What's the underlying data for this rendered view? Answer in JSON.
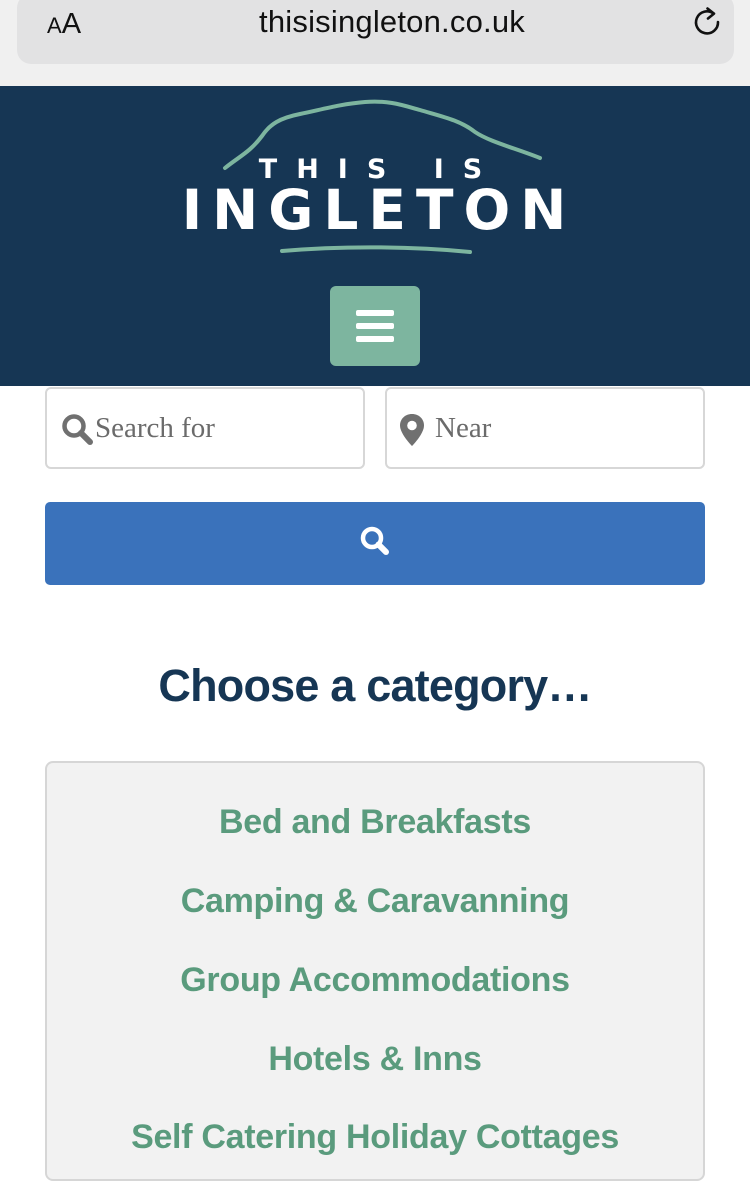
{
  "browser": {
    "text_size_small": "A",
    "text_size_large": "A",
    "url": "thisisingleton.co.uk",
    "reload_icon": "reload-icon"
  },
  "header": {
    "logo_line1": "THIS IS",
    "logo_line2": "INGLETON",
    "menu_icon": "hamburger-menu-icon"
  },
  "search": {
    "search_placeholder": "Search for",
    "search_icon": "search-icon",
    "near_placeholder": "Near",
    "near_icon": "map-pin-icon",
    "submit_icon": "search-icon"
  },
  "categories": {
    "heading": "Choose a category…",
    "items": [
      "Bed and Breakfasts",
      "Camping & Caravanning",
      "Group Accommodations",
      "Hotels & Inns",
      "Self Catering Holiday Cottages"
    ]
  },
  "colors": {
    "header_bg": "#163654",
    "accent_green": "#7db59f",
    "category_text": "#5a9b7d",
    "search_button": "#3a72bb",
    "heading_text": "#163654"
  }
}
